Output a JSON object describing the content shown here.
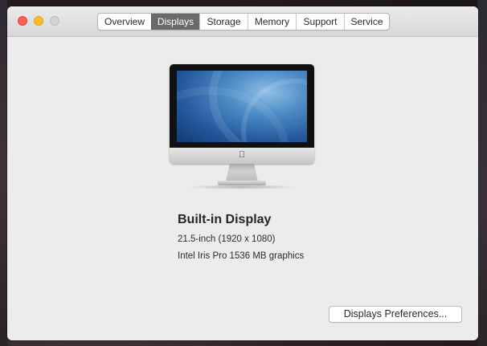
{
  "window": {
    "controls": [
      "close",
      "minimize",
      "zoom"
    ]
  },
  "tabs": [
    {
      "label": "Overview",
      "active": false
    },
    {
      "label": "Displays",
      "active": true
    },
    {
      "label": "Storage",
      "active": false
    },
    {
      "label": "Memory",
      "active": false
    },
    {
      "label": "Support",
      "active": false
    },
    {
      "label": "Service",
      "active": false
    }
  ],
  "display": {
    "name": "Built-in Display",
    "size": "21.5-inch (1920 x 1080)",
    "graphics": "Intel Iris Pro 1536 MB graphics"
  },
  "actions": {
    "preferences_label": "Displays Preferences..."
  },
  "colors": {
    "close": "#ff5f57",
    "minimize": "#febc2e",
    "zoom_inactive": "#d3d3d3",
    "active_tab": "#6a6a6a"
  }
}
